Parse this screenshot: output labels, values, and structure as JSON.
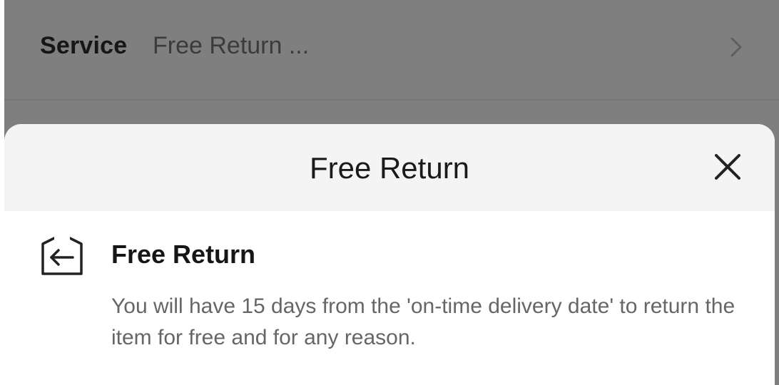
{
  "service_row": {
    "label": "Service",
    "value": "Free Return ...",
    "chevron_icon": "chevron-right-icon"
  },
  "sheet": {
    "title": "Free Return",
    "close_icon": "close-icon",
    "feature": {
      "icon": "return-box-icon",
      "title": "Free Return",
      "description": "You will have 15 days from the 'on-time delivery date' to return the item for free and for any reason."
    }
  },
  "colors": {
    "overlay": "#7f7f7f",
    "sheet_header_bg": "#f4f4f4",
    "sheet_bg": "#ffffff",
    "text_primary": "#161616",
    "text_secondary": "#666666"
  }
}
